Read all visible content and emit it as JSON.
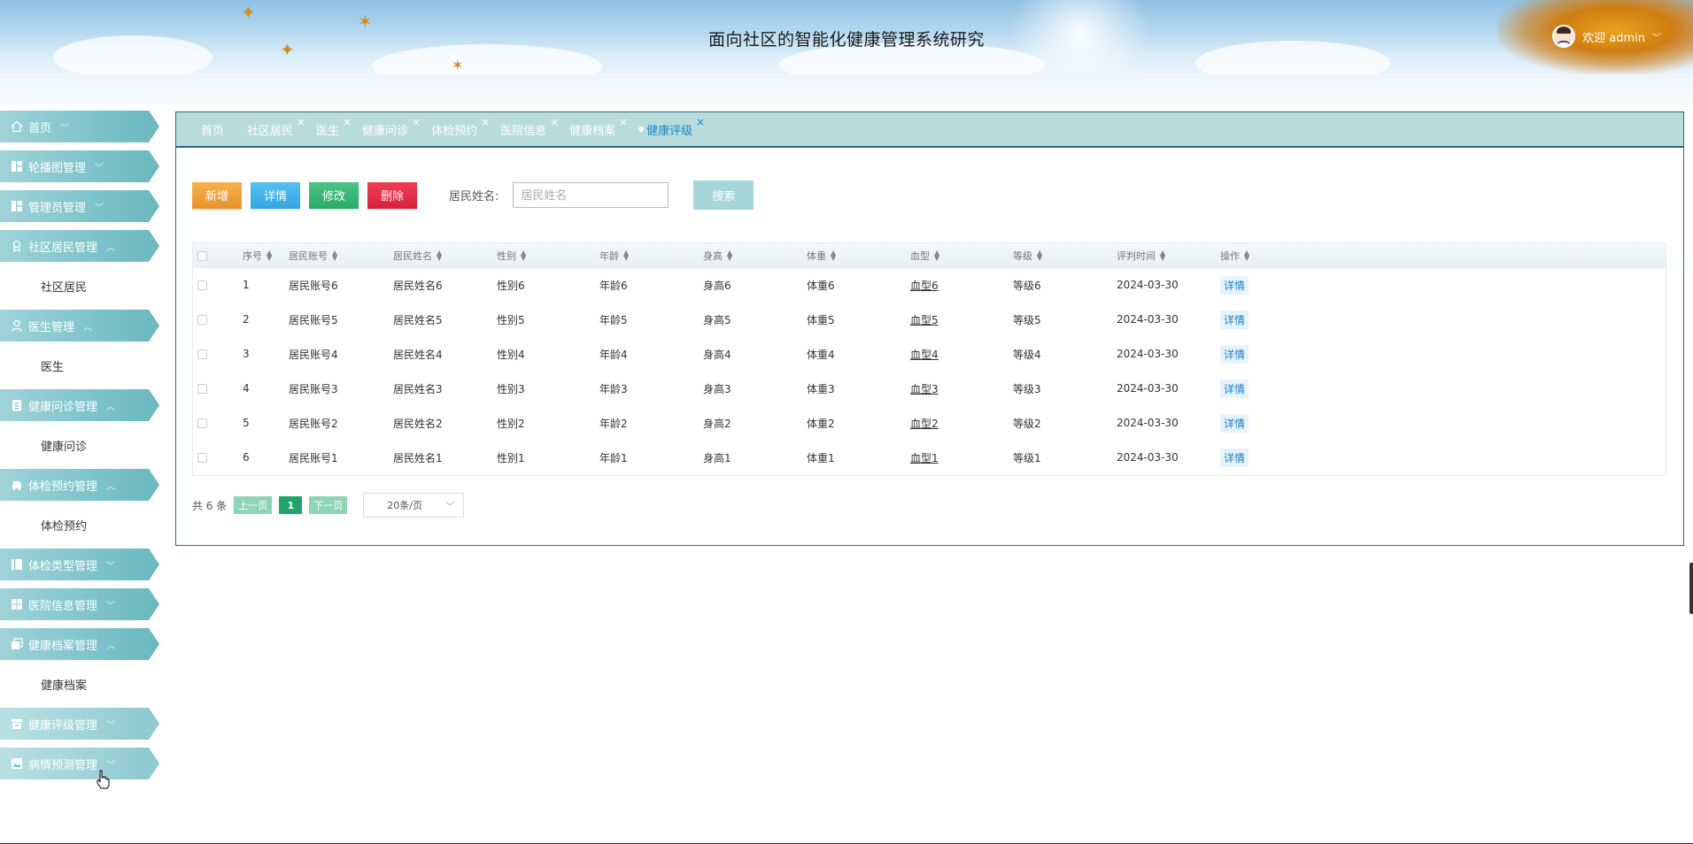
{
  "header": {
    "title": "面向社区的智能化健康管理系统研究",
    "welcome": "欢迎 admin"
  },
  "sidebar": {
    "items": [
      {
        "label": "首页",
        "icon": "home-icon",
        "arrow": "﹀",
        "expanded": false
      },
      {
        "label": "轮播图管理",
        "icon": "grid-icon",
        "arrow": "﹀",
        "expanded": false
      },
      {
        "label": "管理员管理",
        "icon": "grid-icon",
        "arrow": "﹀",
        "expanded": false
      },
      {
        "label": "社区居民管理",
        "icon": "user-badge-icon",
        "arrow": "︿",
        "expanded": true,
        "sub": "社区居民"
      },
      {
        "label": "医生管理",
        "icon": "person-icon",
        "arrow": "︿",
        "expanded": true,
        "sub": "医生"
      },
      {
        "label": "健康问诊管理",
        "icon": "clipboard-icon",
        "arrow": "︿",
        "expanded": true,
        "sub": "健康问诊"
      },
      {
        "label": "体检预约管理",
        "icon": "car-icon",
        "arrow": "︿",
        "expanded": true,
        "sub": "体检预约"
      },
      {
        "label": "体检类型管理",
        "icon": "column-icon",
        "arrow": "﹀",
        "expanded": false
      },
      {
        "label": "医院信息管理",
        "icon": "apps-icon",
        "arrow": "﹀",
        "expanded": false
      },
      {
        "label": "健康档案管理",
        "icon": "copy-icon",
        "arrow": "︿",
        "expanded": true,
        "sub": "健康档案"
      },
      {
        "label": "健康评级管理",
        "icon": "archive-icon",
        "arrow": "﹀",
        "expanded": false
      },
      {
        "label": "病情预测管理",
        "icon": "image-icon",
        "arrow": "﹀",
        "expanded": false
      }
    ]
  },
  "tabs": [
    {
      "label": "首页",
      "closable": false
    },
    {
      "label": "社区居民",
      "closable": true
    },
    {
      "label": "医生",
      "closable": true
    },
    {
      "label": "健康问诊",
      "closable": true
    },
    {
      "label": "体检预约",
      "closable": true
    },
    {
      "label": "医院信息",
      "closable": true
    },
    {
      "label": "健康档案",
      "closable": true
    },
    {
      "label": "健康评级",
      "closable": true,
      "active": true
    }
  ],
  "toolbar": {
    "add_label": "新增",
    "detail_label": "详情",
    "edit_label": "修改",
    "delete_label": "删除",
    "search_label": "居民姓名:",
    "search_placeholder": "居民姓名",
    "search_button": "搜索"
  },
  "table": {
    "columns": [
      "序号",
      "居民账号",
      "居民姓名",
      "性别",
      "年龄",
      "身高",
      "体重",
      "血型",
      "等级",
      "评判时间",
      "操作"
    ],
    "rows": [
      [
        "1",
        "居民账号6",
        "居民姓名6",
        "性别6",
        "年龄6",
        "身高6",
        "体重6",
        "血型6",
        "等级6",
        "2024-03-30",
        "详情"
      ],
      [
        "2",
        "居民账号5",
        "居民姓名5",
        "性别5",
        "年龄5",
        "身高5",
        "体重5",
        "血型5",
        "等级5",
        "2024-03-30",
        "详情"
      ],
      [
        "3",
        "居民账号4",
        "居民姓名4",
        "性别4",
        "年龄4",
        "身高4",
        "体重4",
        "血型4",
        "等级4",
        "2024-03-30",
        "详情"
      ],
      [
        "4",
        "居民账号3",
        "居民姓名3",
        "性别3",
        "年龄3",
        "身高3",
        "体重3",
        "血型3",
        "等级3",
        "2024-03-30",
        "详情"
      ],
      [
        "5",
        "居民账号2",
        "居民姓名2",
        "性别2",
        "年龄2",
        "身高2",
        "体重2",
        "血型2",
        "等级2",
        "2024-03-30",
        "详情"
      ],
      [
        "6",
        "居民账号1",
        "居民姓名1",
        "性别1",
        "年龄1",
        "身高1",
        "体重1",
        "血型1",
        "等级1",
        "2024-03-30",
        "详情"
      ]
    ]
  },
  "pagination": {
    "total": "共 6 条",
    "prev": "上一页",
    "current": "1",
    "next": "下一页",
    "page_size": "20条/页"
  },
  "colors": {
    "accent": "#7cc3c9",
    "tab_bar": "#b8dbdc",
    "border": "#2e6a76",
    "link": "#1e7fc6"
  }
}
